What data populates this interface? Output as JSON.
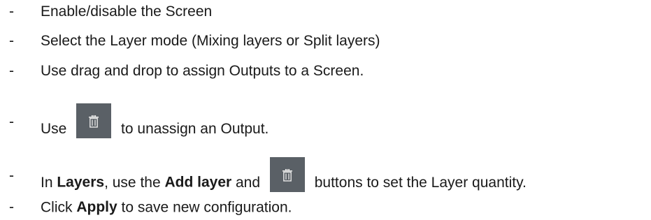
{
  "bullet_glyph": "-",
  "items": [
    {
      "text": "Enable/disable the Screen"
    },
    {
      "text": "Select the Layer mode (Mixing layers or Split layers)"
    },
    {
      "text": "Use drag and drop to assign Outputs to a Screen."
    },
    {
      "before": "Use",
      "after": "to unassign an Output.",
      "icon": "trash-icon"
    },
    {
      "before": "In ",
      "bold1": "Layers",
      "mid": ", use the ",
      "bold2": "Add layer",
      "mid2": " and",
      "after": "buttons to set the Layer quantity.",
      "icon": "trash-icon"
    },
    {
      "before": "Click ",
      "bold": "Apply",
      "after": " to save new configuration."
    }
  ],
  "colors": {
    "button_bg": "#5a6066",
    "icon_stroke": "#e8e8e8",
    "text": "#1a1a1a"
  }
}
